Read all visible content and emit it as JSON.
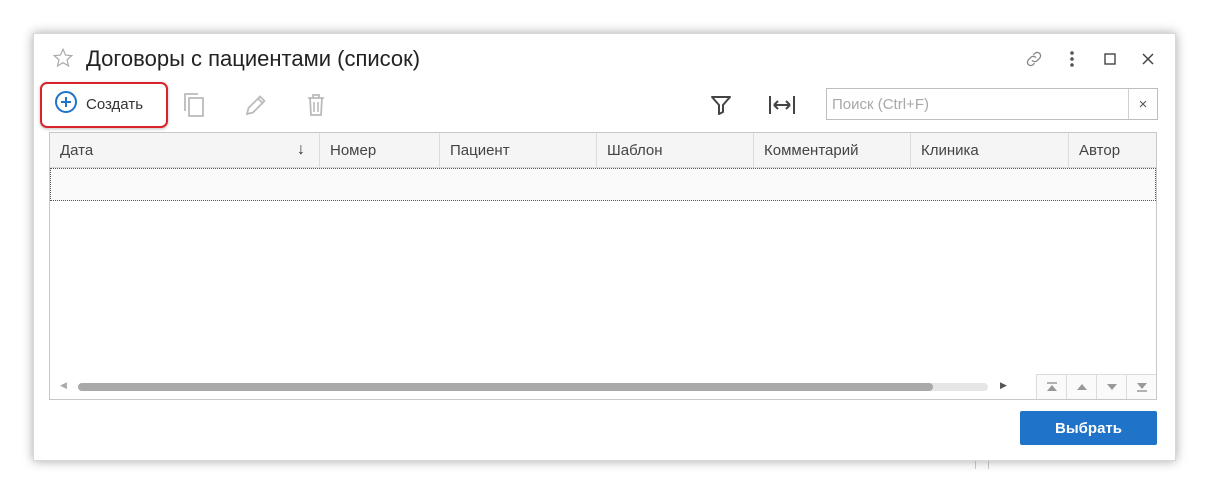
{
  "window": {
    "title": "Договоры с пациентами (список)"
  },
  "toolbar": {
    "create_label": "Создать",
    "icons": [
      "add-circle-icon",
      "copy-icon",
      "edit-icon",
      "delete-icon",
      "filter-icon",
      "fit-width-icon"
    ],
    "accent_color": "#1f73c8",
    "highlight_color": "#d8232a"
  },
  "search": {
    "placeholder": "Поиск (Ctrl+F)",
    "value": "",
    "clear_label": "×"
  },
  "table": {
    "columns": [
      {
        "label": "Дата",
        "sort": "↓"
      },
      {
        "label": "Номер"
      },
      {
        "label": "Пациент"
      },
      {
        "label": "Шаблон"
      },
      {
        "label": "Комментарий"
      },
      {
        "label": "Клиника"
      },
      {
        "label": "Автор"
      }
    ],
    "rows": []
  },
  "footer": {
    "select_label": "Выбрать"
  }
}
